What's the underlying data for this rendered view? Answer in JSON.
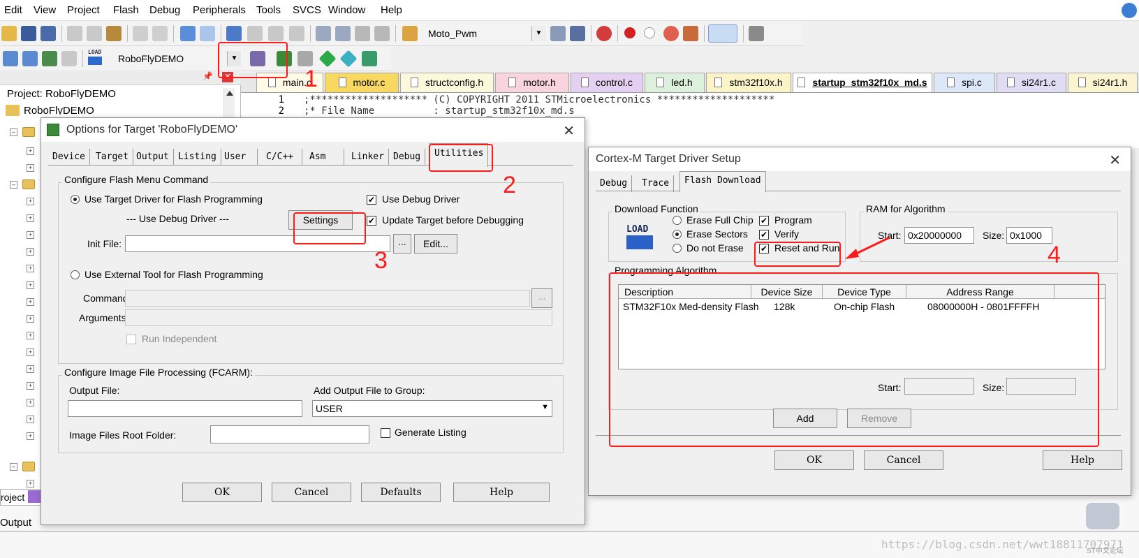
{
  "menu": [
    "Edit",
    "View",
    "Project",
    "Flash",
    "Debug",
    "Peripherals",
    "Tools",
    "SVCS",
    "Window",
    "Help"
  ],
  "toolbar1": {
    "target_combo": "Moto_Pwm"
  },
  "toolbar2": {
    "target_name": "RoboFlyDEMO",
    "load_label": "LOAD"
  },
  "file_tabs": [
    "main.c",
    "motor.c",
    "structconfig.h",
    "motor.h",
    "control.c",
    "led.h",
    "stm32f10x.h",
    "startup_stm32f10x_md.s",
    "spi.c",
    "si24r1.c",
    "si24r1.h"
  ],
  "editor": {
    "lines": [
      {
        "n": "1",
        "text": ";******************** (C) COPYRIGHT 2011 STMicroelectronics ********************"
      },
      {
        "n": "2",
        "text": ";* File Name          : startup_stm32f10x_md.s"
      }
    ]
  },
  "project": {
    "root": "Project: RoboFlyDEMO",
    "child": "RoboFlyDEMO",
    "bottom_tab": "roject",
    "output_label": "Output"
  },
  "options": {
    "title": "Options for Target 'RoboFlyDEMO'",
    "tabs": [
      "Device",
      "Target",
      "Output",
      "Listing",
      "User",
      "C/C++",
      "Asm",
      "Linker",
      "Debug",
      "Utilities"
    ],
    "flash_group": "Configure Flash Menu Command",
    "use_target_driver": "Use Target Driver for Flash Programming",
    "use_debug_driver_dash": "--- Use Debug Driver ---",
    "settings": "Settings",
    "use_debug_driver": "Use Debug Driver",
    "update_target": "Update Target before Debugging",
    "init_file": "Init File:",
    "browse": "...",
    "edit": "Edit...",
    "use_external": "Use External Tool for Flash Programming",
    "command": "Command:",
    "arguments": "Arguments:",
    "run_independent": "Run Independent",
    "image_group": "Configure Image File Processing (FCARM):",
    "output_file": "Output File:",
    "add_output": "Add Output File  to Group:",
    "group_value": "USER",
    "root_folder": "Image Files Root Folder:",
    "generate_listing": "Generate Listing",
    "ok": "OK",
    "cancel": "Cancel",
    "defaults": "Defaults",
    "help": "Help"
  },
  "cortex": {
    "title": "Cortex-M Target Driver Setup",
    "tabs": [
      "Debug",
      "Trace",
      "Flash Download"
    ],
    "download_group": "Download Function",
    "load_label": "LOAD",
    "erase_full": "Erase Full Chip",
    "erase_sectors": "Erase Sectors",
    "do_not_erase": "Do not Erase",
    "program": "Program",
    "verify": "Verify",
    "reset_run": "Reset and Run",
    "ram_group": "RAM for Algorithm",
    "start_label": "Start:",
    "start_value": "0x20000000",
    "size_label": "Size:",
    "size_value": "0x1000",
    "prog_group": "Programming Algorithm",
    "columns": [
      "Description",
      "Device Size",
      "Device Type",
      "Address Range"
    ],
    "row": [
      "STM32F10x Med-density Flash",
      "128k",
      "On-chip Flash",
      "08000000H - 0801FFFFH"
    ],
    "start2": "Start:",
    "size2": "Size:",
    "add": "Add",
    "remove": "Remove",
    "ok": "OK",
    "cancel": "Cancel",
    "help": "Help"
  },
  "annotations": [
    "1",
    "2",
    "3",
    "4"
  ],
  "watermark": "https://blog.csdn.net/wwt18811707971",
  "watermark2": "ST中文论坛",
  "colors": {
    "annotation_red": "#ff1a1a"
  }
}
